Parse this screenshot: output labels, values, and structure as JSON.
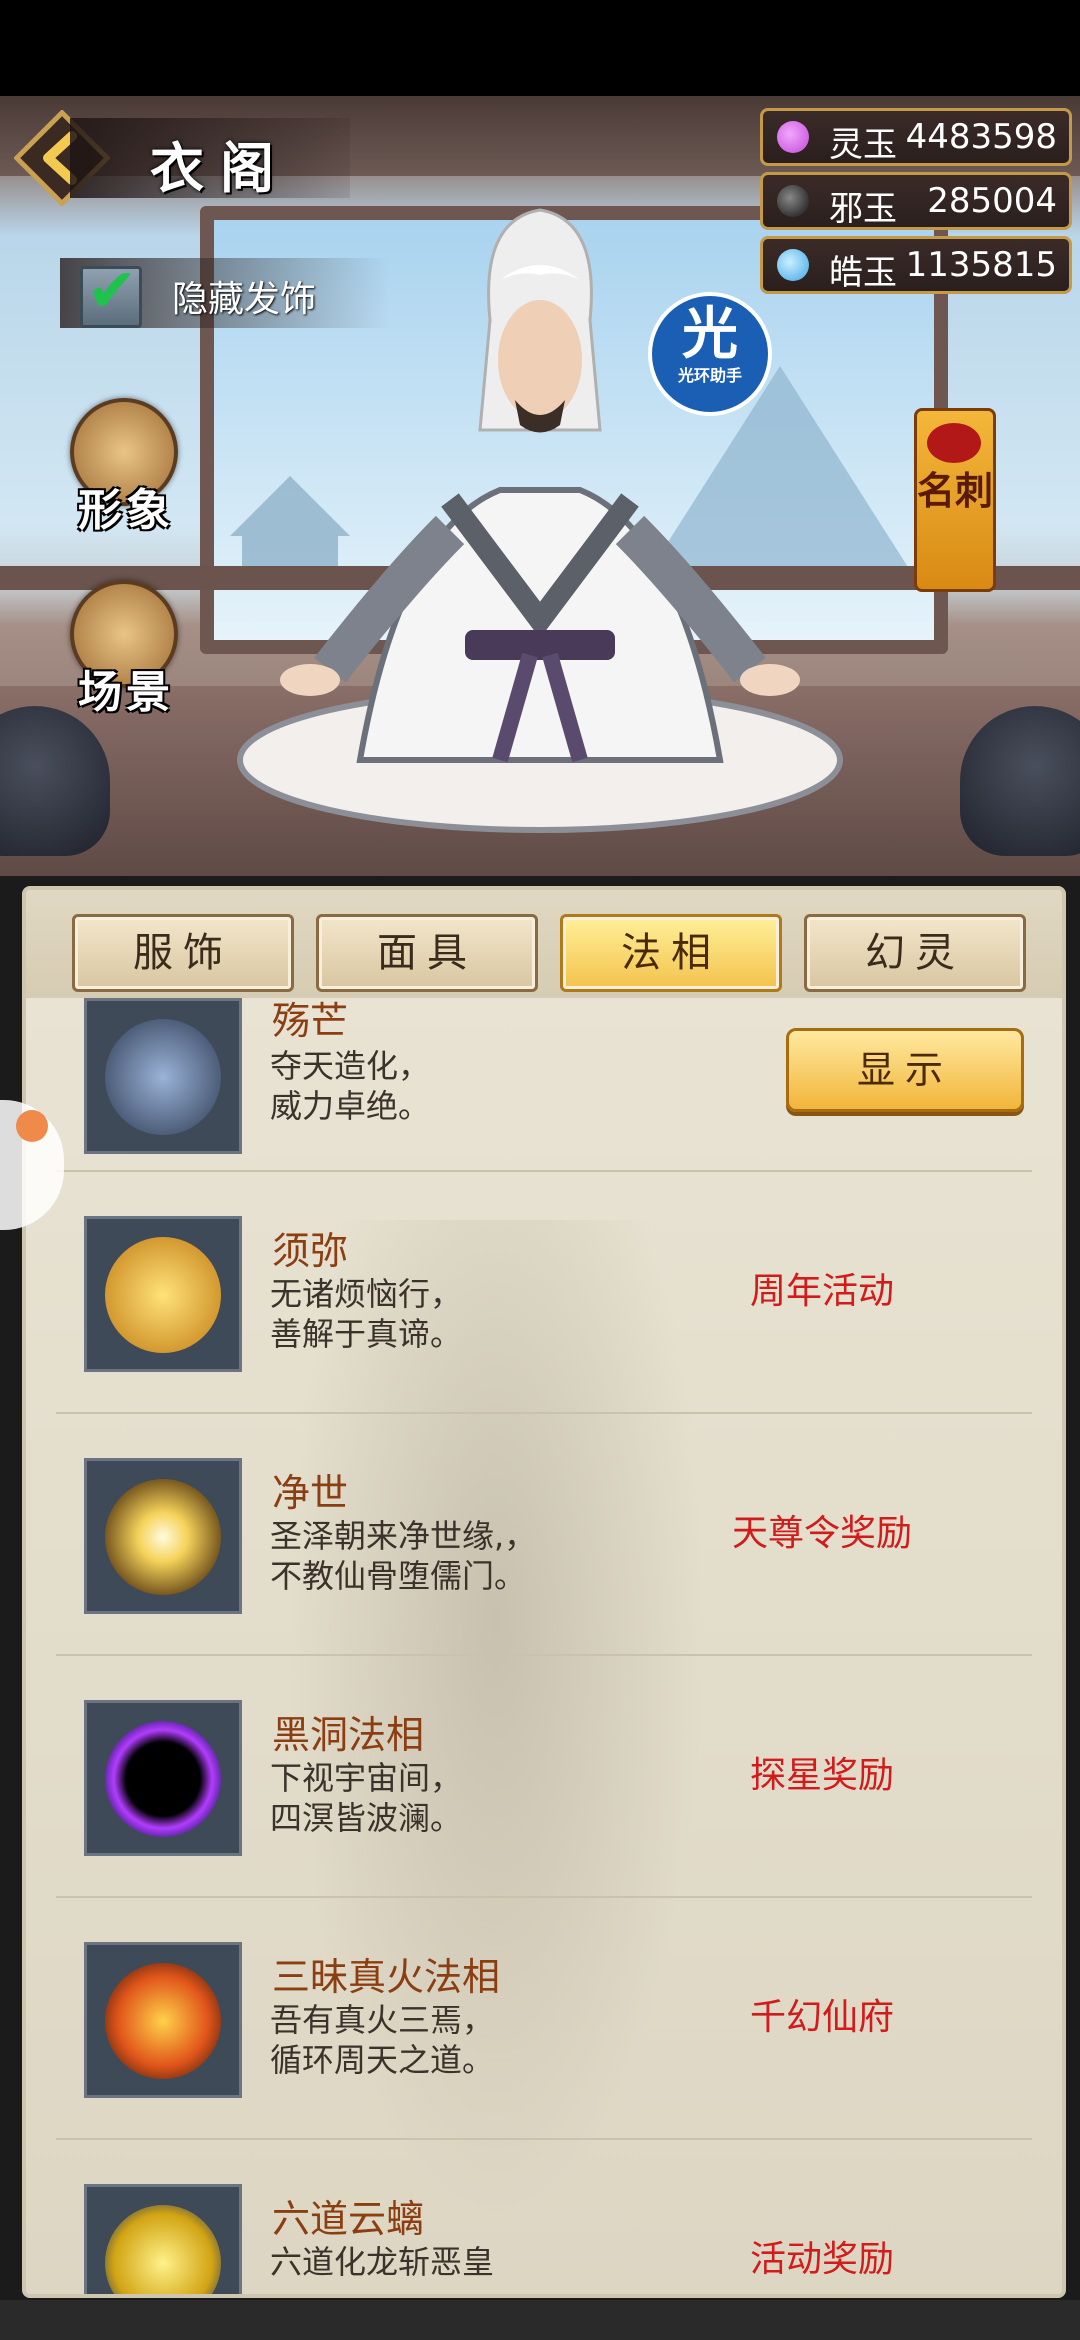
{
  "header": {
    "title": "衣阁"
  },
  "currencies": [
    {
      "name": "灵玉",
      "value": "4483598",
      "color": "#c04ad6"
    },
    {
      "name": "邪玉",
      "value": "285004",
      "color": "#222222"
    },
    {
      "name": "皓玉",
      "value": "1135815",
      "color": "#3fa6e6"
    }
  ],
  "hide_toggle": {
    "label": "隐藏发饰",
    "checked": true
  },
  "side_buttons": {
    "appearance": "形象",
    "scene": "场景"
  },
  "helper_badge": {
    "big": "光",
    "small": "光环助手"
  },
  "card_tag": {
    "label": "名刺"
  },
  "tabs": [
    {
      "label": "服饰",
      "active": false
    },
    {
      "label": "面具",
      "active": false
    },
    {
      "label": "法相",
      "active": true
    },
    {
      "label": "幻灵",
      "active": false
    }
  ],
  "items": [
    {
      "name": "殇芒",
      "desc1": "夺天造化，",
      "desc2": "威力卓绝。",
      "action": "显示",
      "icon": "blades-icon"
    },
    {
      "name": "须弥",
      "desc1": "无诸烦恼行，",
      "desc2": "善解于真谛。",
      "source": "周年活动",
      "icon": "golden-buddha-icon"
    },
    {
      "name": "净世",
      "desc1": "圣泽朝来净世缘,，",
      "desc2": "不教仙骨堕儒门。",
      "source": "天尊令奖励",
      "icon": "golden-orb-icon"
    },
    {
      "name": "黑洞法相",
      "desc1": "下视宇宙间，",
      "desc2": "四溟皆波澜。",
      "source": "探星奖励",
      "icon": "black-hole-icon"
    },
    {
      "name": "三昧真火法相",
      "desc1": "吾有真火三焉，",
      "desc2": "循环周天之道。",
      "source": "千幻仙府",
      "icon": "fire-icon"
    },
    {
      "name": "六道云螭",
      "desc1": "六道化龙斩恶皇",
      "desc2": "",
      "source": "活动奖励",
      "icon": "dragon-icon"
    }
  ]
}
